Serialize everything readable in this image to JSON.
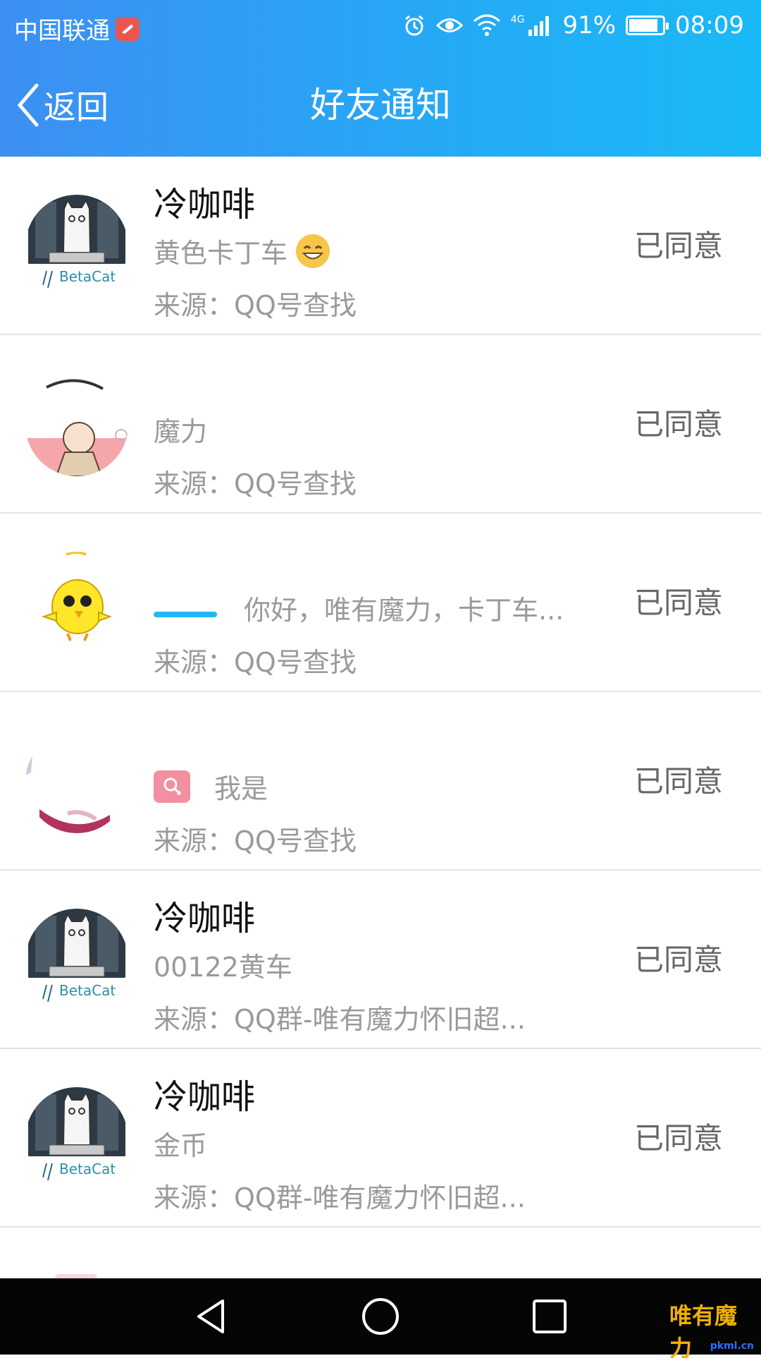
{
  "status_bar": {
    "carrier": "中国联通",
    "battery": "91%",
    "battery_level": 0.91,
    "time": "08:09",
    "network": "4G"
  },
  "header": {
    "back_label": "返回",
    "title": "好友通知"
  },
  "notifications": [
    {
      "name": "冷咖啡",
      "message": "黄色卡丁车",
      "source": "来源：QQ号查找",
      "status": "已同意",
      "avatar_label": "BetaCat"
    },
    {
      "name": "",
      "message": "魔力",
      "source": "来源：QQ号查找",
      "status": "已同意"
    },
    {
      "name": "",
      "message": "你好，唯有魔力，卡丁车...",
      "source": "来源：QQ号查找",
      "status": "已同意"
    },
    {
      "name": "",
      "message": "我是",
      "source": "来源：QQ号查找",
      "status": "已同意"
    },
    {
      "name": "冷咖啡",
      "message": "00122黄车",
      "source": "来源：QQ群-唯有魔力怀旧超...",
      "status": "已同意",
      "avatar_label": "BetaCat"
    },
    {
      "name": "冷咖啡",
      "message": "金币",
      "source": "来源：QQ群-唯有魔力怀旧超...",
      "status": "已同意",
      "avatar_label": "BetaCat"
    }
  ],
  "watermark": {
    "text": "唯有魔力",
    "url": "pkml.cn"
  },
  "colors": {
    "header_start": "#3d8ff2",
    "header_end": "#1ab9f6",
    "status_text": "#666666",
    "secondary_text": "#9a9a9a"
  }
}
